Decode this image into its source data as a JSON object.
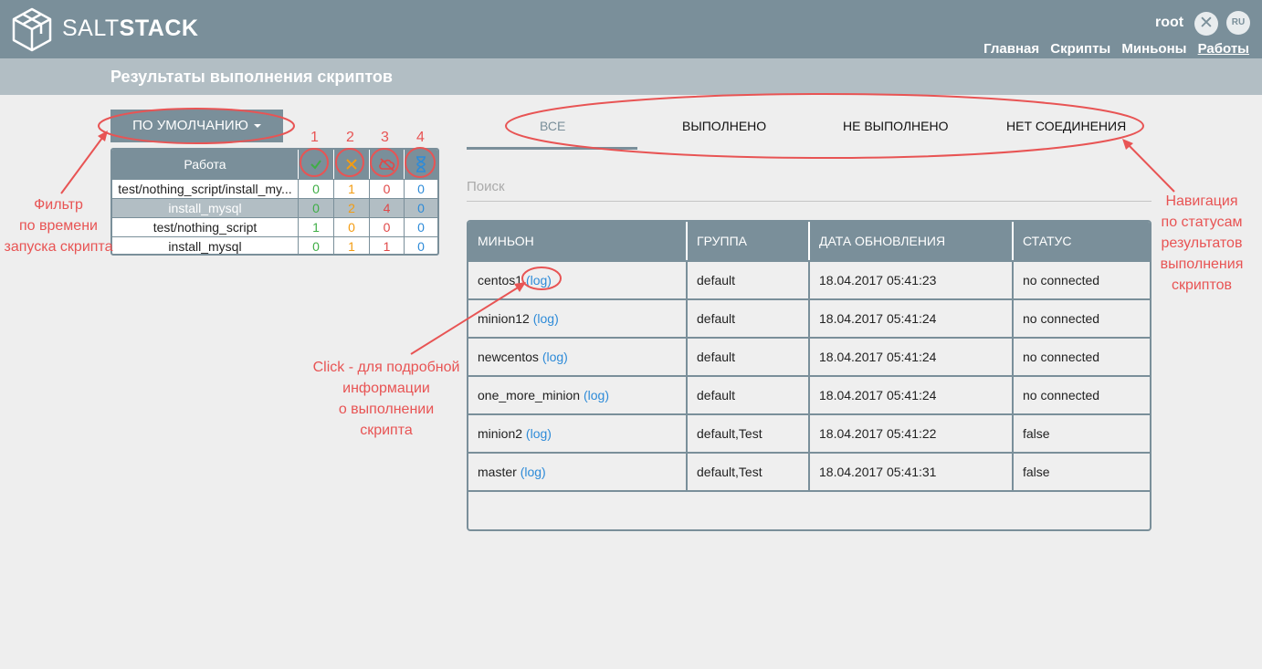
{
  "header": {
    "logo_text_light": "SALT",
    "logo_text_bold": "STACK",
    "user": "root",
    "close_icon_label": "✕",
    "lang_label": "RU",
    "nav": [
      "Главная",
      "Скрипты",
      "Миньоны",
      "Работы"
    ],
    "nav_active": "Работы"
  },
  "page_title": "Результаты выполнения скриптов",
  "filter": {
    "label": "ПО УМОЛЧАНИЮ"
  },
  "jobs": {
    "header": "Работа",
    "status_icons": [
      "check-icon",
      "cross-icon",
      "cloud-off-icon",
      "hourglass-icon"
    ],
    "rows": [
      {
        "name": "test/nothing_script/install_my...",
        "ok": "0",
        "err": "1",
        "nc": "0",
        "wait": "0",
        "selected": false
      },
      {
        "name": "install_mysql",
        "ok": "0",
        "err": "2",
        "nc": "4",
        "wait": "0",
        "selected": true
      },
      {
        "name": "test/nothing_script",
        "ok": "1",
        "err": "0",
        "nc": "0",
        "wait": "0",
        "selected": false
      },
      {
        "name": "install_mysql",
        "ok": "0",
        "err": "1",
        "nc": "1",
        "wait": "0",
        "selected": false
      }
    ]
  },
  "tabs": {
    "all": "ВСЕ",
    "done": "ВЫПОЛНЕНО",
    "failed": "НЕ ВЫПОЛНЕНО",
    "no_conn": "НЕТ СОЕДИНЕНИЯ",
    "active": "all"
  },
  "search": {
    "placeholder": "Поиск"
  },
  "results": {
    "columns": [
      "МИНЬОН",
      "ГРУППА",
      "ДАТА ОБНОВЛЕНИЯ",
      "СТАТУС"
    ],
    "log_label": "(log)",
    "rows": [
      {
        "minion": "centos1",
        "group": "default",
        "date": "18.04.2017 05:41:23",
        "status": "no connected"
      },
      {
        "minion": "minion12",
        "group": "default",
        "date": "18.04.2017 05:41:24",
        "status": "no connected"
      },
      {
        "minion": "newcentos",
        "group": "default",
        "date": "18.04.2017 05:41:24",
        "status": "no connected"
      },
      {
        "minion": "one_more_minion",
        "group": "default",
        "date": "18.04.2017 05:41:24",
        "status": "no connected"
      },
      {
        "minion": "minion2",
        "group": "default,Test",
        "date": "18.04.2017 05:41:22",
        "status": "false"
      },
      {
        "minion": "master",
        "group": "default,Test",
        "date": "18.04.2017 05:41:31",
        "status": "false"
      }
    ]
  },
  "annotations": {
    "filter_note": [
      "Фильтр",
      "по времени",
      "запуска скрипта"
    ],
    "click_note": [
      "Click - для подробной",
      "информации",
      "о выполнении",
      "скрипта"
    ],
    "nav_note": [
      "Навигация",
      "по статусам",
      "результатов",
      "выполнения",
      "скриптов"
    ],
    "numbers": [
      "1",
      "2",
      "3",
      "4"
    ]
  },
  "colors": {
    "header_bg": "#7a8f9a",
    "subheader_bg": "#b2bec4",
    "ok": "#3fae46",
    "error": "#f39c12",
    "no_connection": "#e04848",
    "waiting": "#2e8bd8",
    "annotation": "#e85454",
    "link": "#2e8bd8"
  }
}
